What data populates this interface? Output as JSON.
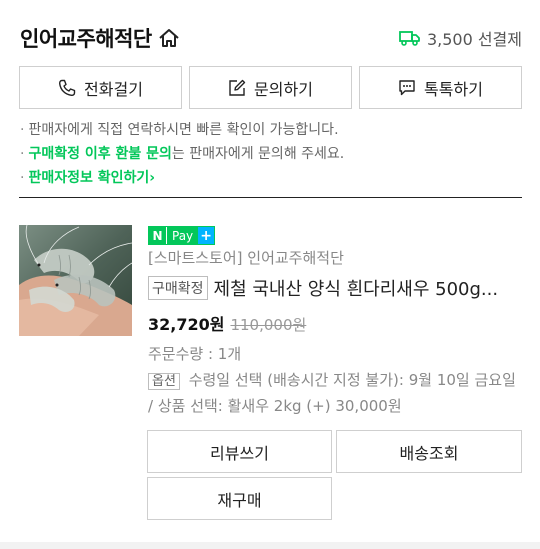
{
  "header": {
    "seller_name": "인어교주해적단",
    "shipping_fee": "3,500 선결제",
    "icons": {
      "home": "home-icon",
      "truck": "truck-icon"
    },
    "colors": {
      "truck": "#03c75a"
    }
  },
  "contact": {
    "buttons": [
      {
        "label": "전화걸기",
        "icon": "phone-icon"
      },
      {
        "label": "문의하기",
        "icon": "edit-icon"
      },
      {
        "label": "톡톡하기",
        "icon": "chat-icon"
      }
    ]
  },
  "notices": {
    "line1": "판매자에게 직접 연락하시면 빠른 확인이 가능합니다.",
    "line2_highlight": "구매확정 이후 환불 문의",
    "line2_rest": "는 판매자에게 문의해 주세요.",
    "line3_link": "판매자정보 확인하기"
  },
  "order": {
    "badge": {
      "n": "N",
      "pay": "Pay",
      "plus": "+"
    },
    "store": "[스마트스토어] 인어교주해적단",
    "status_tag": "구매확정",
    "product_name": "제철 국내산 양식 흰다리새우 500g...",
    "price": "32,720원",
    "original_price": "110,000원",
    "quantity": "주문수량 : 1개",
    "option_tag": "옵션",
    "option_text": "수령일 선택 (배송시간 지정 불가): 9월 10일 금요일 / 상품 선택: 활새우 2kg (+) 30,000원",
    "colors": {
      "brand_green": "#03c75a",
      "npay_plus": "#00b4ff"
    }
  },
  "actions": {
    "review": "리뷰쓰기",
    "track": "배송조회",
    "rebuy": "재구매"
  }
}
